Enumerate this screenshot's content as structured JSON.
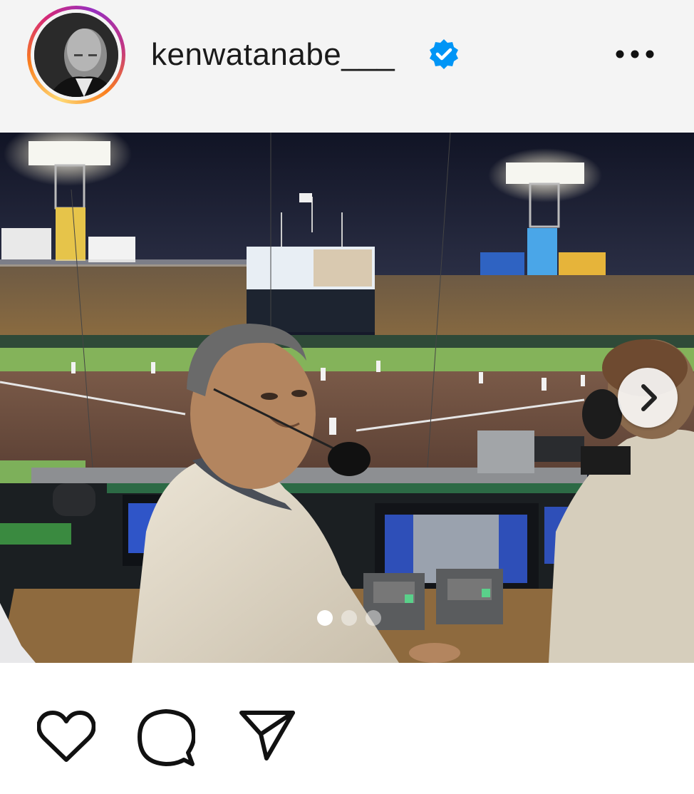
{
  "post": {
    "username": "kenwatanabe___",
    "verified": true,
    "more_icon": "more-horizontal-icon",
    "carousel": {
      "current_index": 1,
      "total": 3,
      "next_icon": "chevron-right-icon"
    }
  },
  "actions": [
    {
      "name": "like-button",
      "icon": "heart-icon"
    },
    {
      "name": "comment-button",
      "icon": "comment-bubble-icon"
    },
    {
      "name": "share-button",
      "icon": "paper-plane-icon"
    }
  ],
  "colors": {
    "verified_blue": "#0095f6",
    "header_bg": "#f4f4f4",
    "text": "#1a1a1a"
  }
}
